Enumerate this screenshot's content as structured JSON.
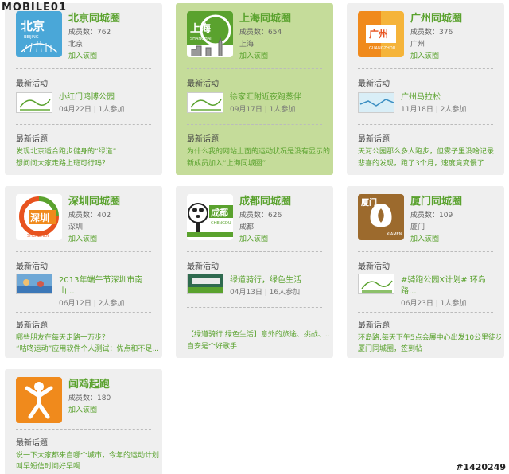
{
  "watermark": {
    "top": "MOBILE01",
    "bottom": "#1420249"
  },
  "labels": {
    "latest_activity": "最新活动",
    "latest_topic": "最新话题"
  },
  "cards": [
    {
      "name": "北京同城圈",
      "members": "成员数：762",
      "city": "北京",
      "join": "加入该圈",
      "logo": {
        "text": "北京",
        "sub": "BEIJING",
        "color": "#4aa7d8"
      },
      "activity": {
        "title": "小红门鸿博公园",
        "meta": "04月22日 | 1人参加"
      },
      "topics": [
        "发现北京适合跑步健身的“绿道”",
        "想问问大家走路上班可行吗？"
      ]
    },
    {
      "name": "上海同城圈",
      "members": "成员数：654",
      "city": "上海",
      "join": "加入该圈",
      "logo": {
        "text": "上海",
        "sub": "SHANGHAI",
        "color": "#5aa22e"
      },
      "activity": {
        "title": "徐家汇附近夜跑蒸伴",
        "meta": "09月17日 | 1人参加"
      },
      "topics": [
        "为什么我的网站上面的运动状况是没有显示的...",
        "新成员加入“上海同城圈”"
      ]
    },
    {
      "name": "广州同城圈",
      "members": "成员数：376",
      "city": "广州",
      "join": "加入该圈",
      "logo": {
        "text": "广州",
        "sub": "GUANGZHOU",
        "color": "#f08a1c"
      },
      "activity": {
        "title": "广州马拉松",
        "meta": "11月18日 | 2人参加"
      },
      "topics": [
        "天河公园那么多人跑步，但雾子里没啥记录",
        "悲喜的发现，跑了3个月，速度竟变慢了"
      ]
    },
    {
      "name": "深圳同城圈",
      "members": "成员数：402",
      "city": "深圳",
      "join": "加入该圈",
      "logo": {
        "text": "深圳",
        "sub": "SHENZHEN",
        "color": "#e8531f"
      },
      "activity": {
        "title": "2013年端午节深圳市南山...",
        "meta": "06月12日 | 2人参加"
      },
      "topics": [
        "哪些朋友在每天走路一万步？",
        "“咕咚运动”应用软件个人测试：优点和不足..."
      ]
    },
    {
      "name": "成都同城圈",
      "members": "成员数：626",
      "city": "成都",
      "join": "加入该圈",
      "logo": {
        "text": "成都",
        "sub": "CHENGDU",
        "color": "#5aa22e"
      },
      "activity": {
        "title": "绿道骑行，绿色生活",
        "meta": "04月13日 | 16人参加"
      },
      "topics": [
        "【绿道骑行 绿色生活】意外的旅途、挑战、...",
        "自安是个好歌手"
      ]
    },
    {
      "name": "厦门同城圈",
      "members": "成员数：109",
      "city": "厦门",
      "join": "加入该圈",
      "logo": {
        "text": "厦门",
        "sub": "XIAMEN",
        "color": "#9c6a2d"
      },
      "activity": {
        "title": "#骑跑公园X计划# 环岛路...",
        "meta": "06月23日 | 1人参加"
      },
      "topics": [
        "环岛路,每天下午5点会展中心出发10公里徒步",
        "厦门同城圈，签到帖"
      ]
    },
    {
      "name": "闻鸡起跑",
      "members": "成员数：180",
      "city": "",
      "join": "加入该圈",
      "logo": {
        "text": "",
        "sub": "",
        "color": "#f08a1c"
      },
      "activity": null,
      "topics": [
        "说一下大家都来自哪个城市，今年的运动计划...",
        "叫早短信时间好早啊"
      ]
    }
  ]
}
